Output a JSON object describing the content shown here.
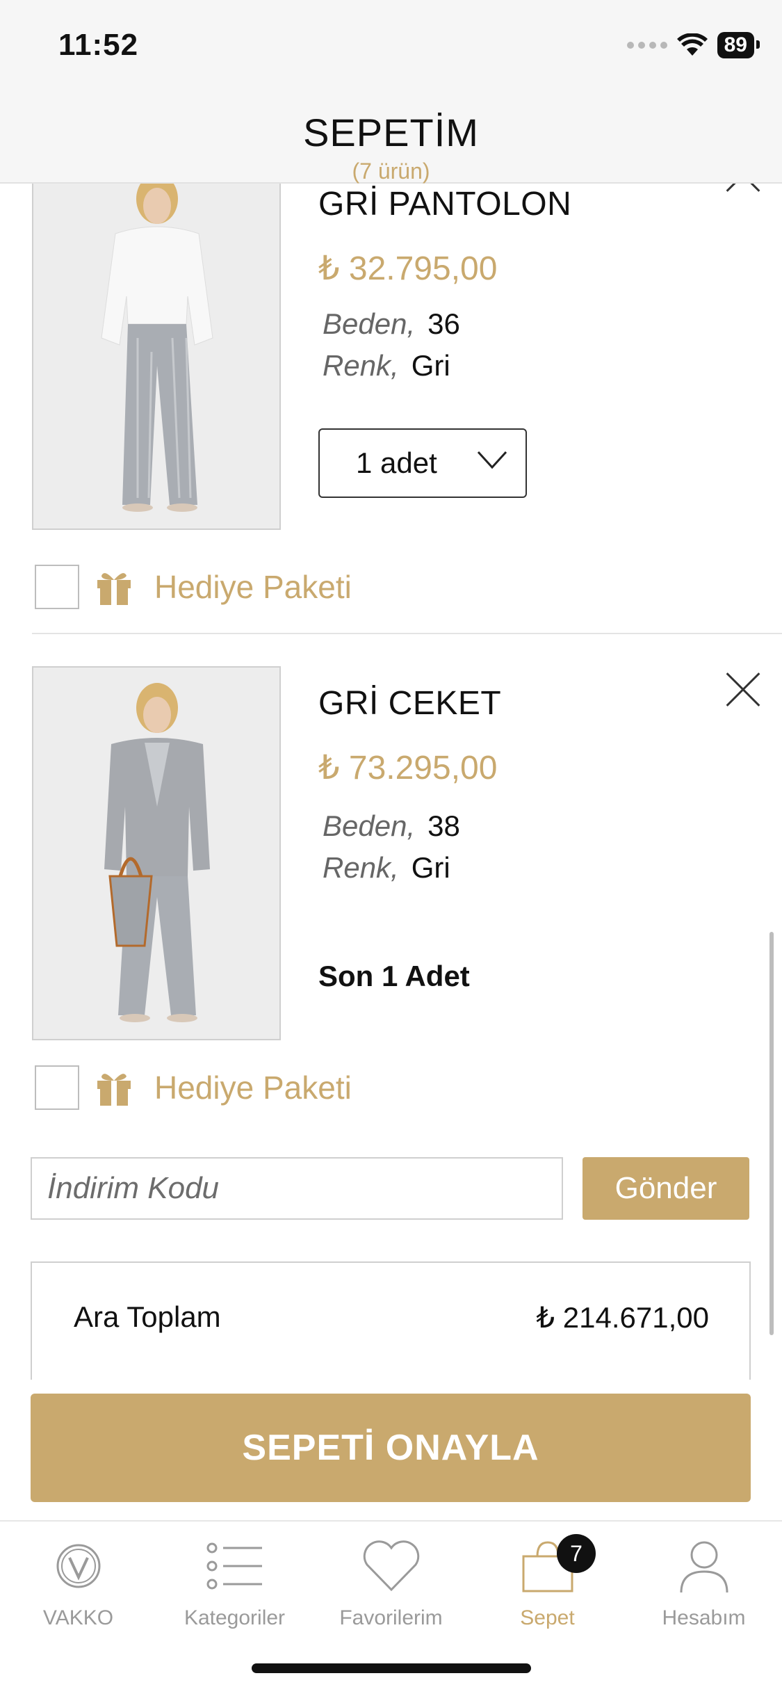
{
  "status": {
    "time": "11:52",
    "battery": "89"
  },
  "header": {
    "title": "SEPETİM",
    "count": "(7 ürün)"
  },
  "cart_items": [
    {
      "name": "GRİ PANTOLON",
      "price": "₺ 32.795,00",
      "size_label": "Beden,",
      "size_value": "36",
      "color_label": "Renk,",
      "color_value": "Gri",
      "quantity": "1 adet",
      "gift_label": "Hediye Paketi"
    },
    {
      "name": "GRİ CEKET",
      "price": "₺ 73.295,00",
      "size_label": "Beden,",
      "size_value": "38",
      "color_label": "Renk,",
      "color_value": "Gri",
      "stock_note": "Son 1 Adet",
      "gift_label": "Hediye Paketi"
    }
  ],
  "discount": {
    "placeholder": "İndirim Kodu",
    "button_label": "Gönder"
  },
  "summary": {
    "subtotal_label": "Ara Toplam",
    "subtotal_value": "₺ 214.671,00"
  },
  "confirm_button": "SEPETİ ONAYLA",
  "tabs": [
    {
      "label": "VAKKO",
      "icon": "vakko-logo-icon"
    },
    {
      "label": "Kategoriler",
      "icon": "list-icon"
    },
    {
      "label": "Favorilerim",
      "icon": "heart-icon"
    },
    {
      "label": "Sepet",
      "icon": "bag-icon",
      "badge": "7"
    },
    {
      "label": "Hesabım",
      "icon": "user-icon"
    }
  ],
  "colors": {
    "accent": "#c9a96e",
    "text": "#111111",
    "muted": "#9a9a9a"
  }
}
